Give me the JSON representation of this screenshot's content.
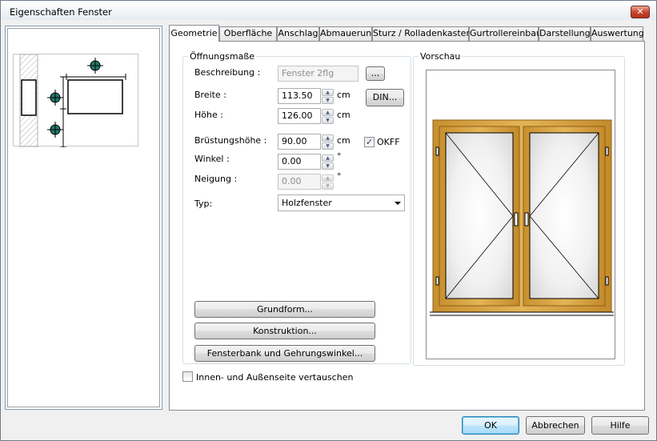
{
  "window": {
    "title": "Eigenschaften Fenster",
    "close_symbol": "✕"
  },
  "tabs": [
    {
      "label": "Geometrie",
      "active": true
    },
    {
      "label": "Oberfläche"
    },
    {
      "label": "Anschlag"
    },
    {
      "label": "Abmauerung"
    },
    {
      "label": "Sturz / Rolladenkasten"
    },
    {
      "label": "Gurtrollereinbau"
    },
    {
      "label": "Darstellung"
    },
    {
      "label": "Auswertung"
    }
  ],
  "openings": {
    "legend": "Öffnungsmaße",
    "description_label": "Beschreibung :",
    "description_value": "Fenster 2flg",
    "browse_label": "...",
    "width_label": "Breite :",
    "width_value": "113.50",
    "width_unit": "cm",
    "height_label": "Höhe :",
    "height_value": "126.00",
    "height_unit": "cm",
    "din_label": "DIN...",
    "sill_label": "Brüstungshöhe :",
    "sill_value": "90.00",
    "sill_unit": "cm",
    "okff_label": "OKFF",
    "okff_checked": true,
    "angle_label": "Winkel :",
    "angle_value": "0.00",
    "angle_unit": "°",
    "tilt_label": "Neigung :",
    "tilt_value": "0.00",
    "tilt_unit": "°",
    "type_label": "Typ:",
    "type_value": "Holzfenster",
    "btn_shape": "Grundform...",
    "btn_construction": "Konstruktion...",
    "btn_sill": "Fensterbank und Gehrungswinkel..."
  },
  "preview": {
    "legend": "Vorschau"
  },
  "swap_label": "Innen- und Außenseite vertauschen",
  "swap_checked": false,
  "footer": {
    "ok": "OK",
    "cancel": "Abbrechen",
    "help": "Hilfe"
  },
  "colors": {
    "frame_wood": "#d9a63f",
    "frame_dark": "#8a5f18",
    "marker_fill": "#1f7a6a",
    "accent": "#3c7fb1"
  }
}
